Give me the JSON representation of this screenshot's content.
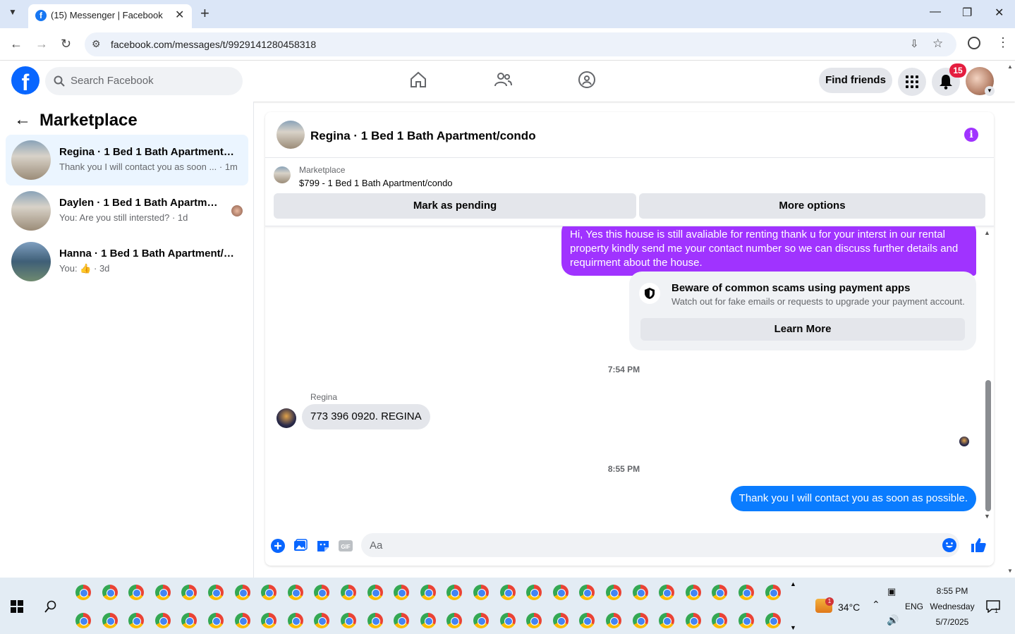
{
  "browser": {
    "tab_title": "(15) Messenger | Facebook",
    "url": "facebook.com/messages/t/9929141280458318"
  },
  "header": {
    "search_placeholder": "Search Facebook",
    "find_friends": "Find friends",
    "notification_count": "15"
  },
  "sidebar": {
    "title": "Marketplace",
    "conversations": [
      {
        "name": "Regina · 1 Bed 1 Bath Apartment/c...",
        "preview": "Thank you I will contact you as soon ... · 1m"
      },
      {
        "name": "Daylen · 1 Bed 1 Bath Apartment...",
        "preview": "You: Are you still intersted? · 1d"
      },
      {
        "name": "Hanna · 1 Bed 1 Bath Apartment/c...",
        "preview_prefix": "You:",
        "preview_suffix": "· 3d"
      }
    ]
  },
  "chat": {
    "title": "Regina · 1 Bed 1 Bath Apartment/condo",
    "listing_label": "Marketplace",
    "listing": "$799 - 1 Bed 1 Bath Apartment/condo",
    "mark_pending": "Mark as pending",
    "more_options": "More options",
    "messages": {
      "outgoing_1": "Hi, Yes this house is still avaliable for renting thank u for your interst in our rental property kindly send me your contact number so we can discuss further details and requirment about the house.",
      "scam_title": "Beware of common scams using payment apps",
      "scam_desc": "Watch out for fake emails or requests to upgrade your payment account.",
      "learn_more": "Learn More",
      "time_1": "7:54 PM",
      "sender": "Regina",
      "incoming_1": "773 396 0920.  REGINA",
      "time_2": "8:55 PM",
      "outgoing_2": "Thank you I will contact  you as soon as possible."
    },
    "composer_placeholder": "Aa"
  },
  "taskbar": {
    "weather": "34°C",
    "lang": "ENG",
    "time": "8:55 PM",
    "day": "Wednesday",
    "date": "5/7/2025",
    "weather_badge": "1",
    "notif_count": "1"
  }
}
